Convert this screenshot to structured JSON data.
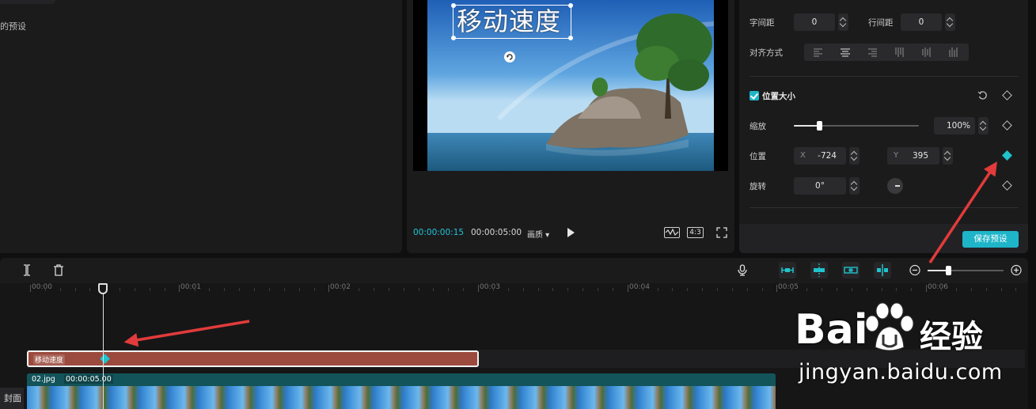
{
  "left_panel": {
    "preset_text": "的预设"
  },
  "player": {
    "overlay_text": "移动速度",
    "current_time": "00:00:00:15",
    "total_time": "00:00:05:00",
    "quality_label": "画质",
    "ratio_label": "4:3"
  },
  "properties": {
    "char_spacing_label": "字间距",
    "char_spacing_value": "0",
    "line_spacing_label": "行间距",
    "line_spacing_value": "0",
    "align_label": "对齐方式",
    "position_size_title": "位置大小",
    "scale_label": "缩放",
    "scale_value": "100%",
    "scale_fraction": 0.2,
    "position_label": "位置",
    "x_axis": "X",
    "x_value": "-724",
    "y_axis": "Y",
    "y_value": "395",
    "rotation_label": "旋转",
    "rotation_value": "0°",
    "save_preset_label": "保存预设"
  },
  "timeline": {
    "ruler": [
      "00:00",
      "00:01",
      "00:02",
      "00:03",
      "00:04",
      "00:05",
      "00:06"
    ],
    "text_clip_name": "移动速度",
    "video_clip_name": "02.jpg",
    "video_clip_duration": "00:00:05.00",
    "cover_label": "封面"
  },
  "watermark": {
    "brand_text": "Bai",
    "brand_suffix": "经验",
    "url": "jingyan.baidu.com"
  },
  "colors": {
    "accent": "#1fc3cc",
    "text_clip": "#9b4a3d",
    "video_clip": "#0e5f64",
    "annotation": "#e23b3b"
  }
}
